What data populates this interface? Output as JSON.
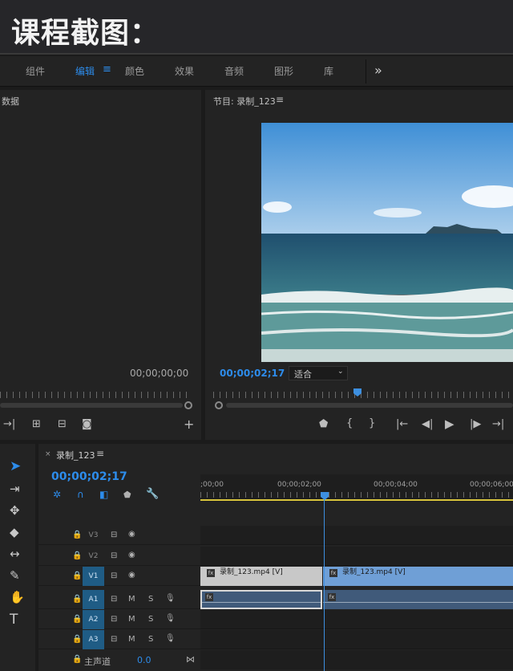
{
  "header": {
    "title": "课程截图："
  },
  "workspace": {
    "tabs": [
      "组件",
      "编辑",
      "颜色",
      "效果",
      "音频",
      "图形",
      "库"
    ],
    "active": "编辑",
    "more": "»"
  },
  "source": {
    "title": "数据",
    "timecode": "00;00;00;00"
  },
  "program": {
    "title": "节目: 录制_123",
    "timecode": "00;00;02;17",
    "fit": "适合"
  },
  "timeline": {
    "sequence": "录制_123",
    "timecode": "00;00;02;17",
    "ruler": [
      ";00;00",
      "00;00;02;00",
      "00;00;04;00",
      "00;00;06;00"
    ],
    "video_tracks": [
      "V3",
      "V2",
      "V1"
    ],
    "audio_tracks": [
      "A1",
      "A2",
      "A3"
    ],
    "mute": "M",
    "solo": "S",
    "master": {
      "label": "主声道",
      "value": "0.0"
    },
    "clips": {
      "v1a": "录制_123.mp4 [V]",
      "v1b": "录制_123.mp4 [V]"
    }
  },
  "colors": {
    "accent": "#2d8ceb",
    "playhead": "#3d8fe0",
    "track_on": "#1f5c85",
    "clip_video_a": "#c8c8c8",
    "clip_video_b": "#6f9fd6",
    "clip_audio": "#405a7a"
  }
}
